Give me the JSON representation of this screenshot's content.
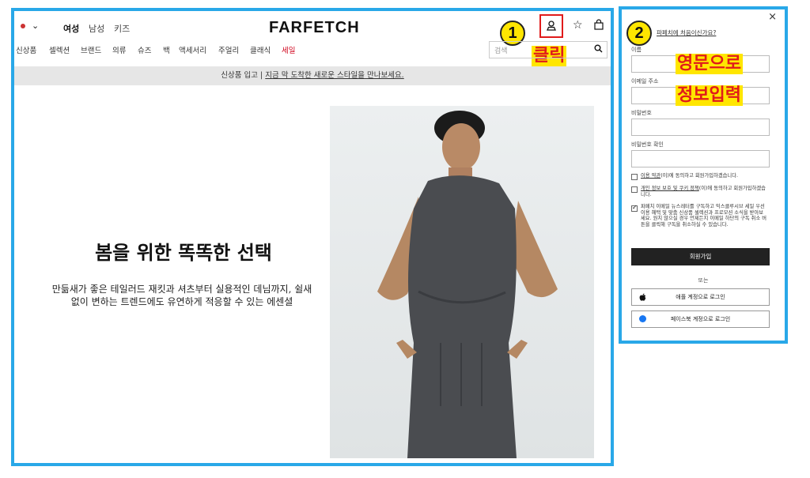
{
  "header": {
    "gender_tabs": [
      "여성",
      "남성",
      "키즈"
    ],
    "logo": "FARFETCH",
    "nav": [
      "신상품",
      "셀렉션",
      "브랜드",
      "의류",
      "슈즈",
      "백",
      "액세서리",
      "주얼리",
      "클래식",
      "세일"
    ],
    "search_placeholder": "검색"
  },
  "banner": {
    "prefix": "신상품 입고  |",
    "link": "지금 막 도착한 새로운 스타일을 만나보세요."
  },
  "hero": {
    "headline": "봄을 위한 똑똑한 선택",
    "body": "만듦새가 좋은 테일러드 재킷과 셔츠부터 실용적인 데님까지, 쉴새 없이 변하는 트렌드에도 유연하게 적응할 수 있는 에센셜"
  },
  "annotations": {
    "step1": "1",
    "step1_label": "클릭",
    "step2": "2",
    "step2_label_line1": "영문으로",
    "step2_label_line2": "정보입력",
    "highlight_color": "#ffe600",
    "label_color": "#e01b1b",
    "frame_color": "#29a8e8"
  },
  "signup": {
    "close": "×",
    "prompt": "파페치에 처음이신가요?",
    "name_label": "이름",
    "email_label": "이메일 주소",
    "password_label": "비밀번호",
    "password_confirm_label": "비밀번호 확인",
    "terms": {
      "link": "이용 약관",
      "text": "(이)에 동의하고 회원가입하겠습니다.",
      "checked": false
    },
    "privacy": {
      "link": "개인 정보 보호 및 쿠키 정책",
      "text": "(이)에 동의하고 회원가입하겠습니다.",
      "checked": false
    },
    "newsletter": {
      "text": "파페치 이메일 뉴스레터를 구독하고 익스클루시브 세일 우선 이용 혜택 및 맞춤 신상품 셀렉션과 프로모션 소식을 받아보세요. 원치 않으실 경우 언제든지 이메일 하단의 구독 취소 버튼을 클릭해 구독을 취소하실 수 있습니다.",
      "checked": true
    },
    "submit": "회원가입",
    "or": "또는",
    "apple": "애플 계정으로 로그인",
    "facebook": "페이스북 계정으로 로그인"
  }
}
